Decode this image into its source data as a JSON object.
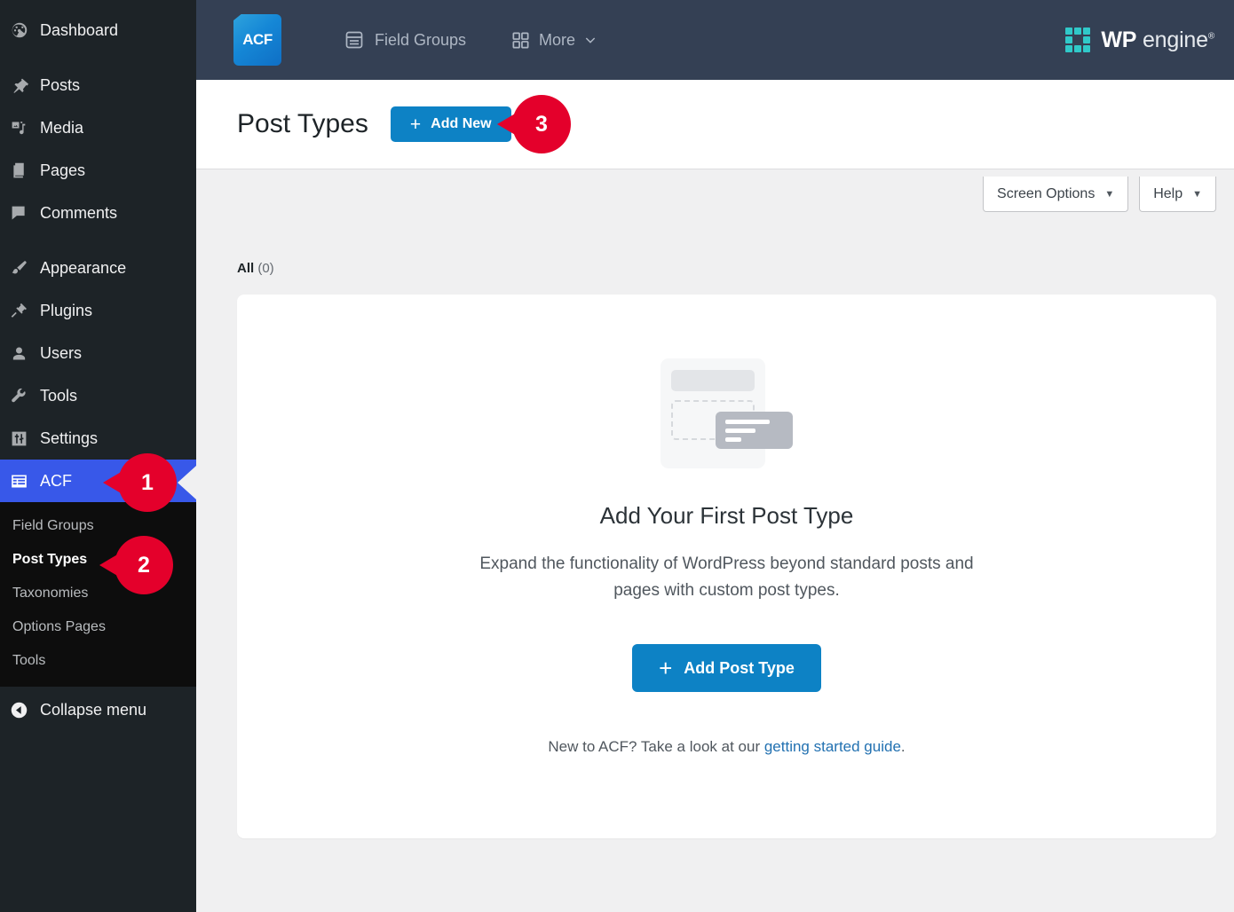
{
  "sidebar": {
    "items": [
      {
        "label": "Dashboard",
        "icon": "dashboard-icon",
        "active": false
      },
      {
        "label": "Posts",
        "icon": "pin-icon",
        "active": false
      },
      {
        "label": "Media",
        "icon": "media-icon",
        "active": false
      },
      {
        "label": "Pages",
        "icon": "pages-icon",
        "active": false
      },
      {
        "label": "Comments",
        "icon": "comments-icon",
        "active": false
      },
      {
        "label": "Appearance",
        "icon": "brush-icon",
        "active": false
      },
      {
        "label": "Plugins",
        "icon": "plug-icon",
        "active": false
      },
      {
        "label": "Users",
        "icon": "user-icon",
        "active": false
      },
      {
        "label": "Tools",
        "icon": "wrench-icon",
        "active": false
      },
      {
        "label": "Settings",
        "icon": "settings-sliders-icon",
        "active": false
      },
      {
        "label": "ACF",
        "icon": "acf-table-icon",
        "active": true
      }
    ],
    "submenu": [
      {
        "label": "Field Groups",
        "current": false
      },
      {
        "label": "Post Types",
        "current": true
      },
      {
        "label": "Taxonomies",
        "current": false
      },
      {
        "label": "Options Pages",
        "current": false
      },
      {
        "label": "Tools",
        "current": false
      }
    ],
    "collapse_label": "Collapse menu",
    "collapse_icon": "chevron-left-circle-icon",
    "active_color": "#3858e9"
  },
  "topbar": {
    "logo_text": "ACF",
    "links": [
      {
        "label": "Field Groups",
        "icon": "list-card-icon"
      },
      {
        "label": "More",
        "icon": "grid-2x2-icon",
        "caret": "chevron-down-icon"
      }
    ],
    "brand": {
      "wp": "WP",
      "engine": "engine",
      "tm": "®"
    },
    "bg_color": "#344054",
    "brand_accent": "#30c9c9"
  },
  "page": {
    "title": "Post Types",
    "add_new_label": "Add New",
    "add_new_plus": "+",
    "screen_options_label": "Screen Options",
    "help_label": "Help",
    "caret": "▼",
    "filter_all_label": "All",
    "filter_all_count": "(0)"
  },
  "empty_state": {
    "title": "Add Your First Post Type",
    "description": "Expand the functionality of WordPress beyond standard posts and pages with custom post types.",
    "button_label": "Add Post Type",
    "button_plus": "+",
    "footer_prefix": "New to ACF? Take a look at our ",
    "footer_link": "getting started guide",
    "footer_suffix": ".",
    "button_color": "#0d82c5",
    "link_color": "#2271b1"
  },
  "callouts": [
    {
      "number": "1",
      "target": "sidebar-item-acf"
    },
    {
      "number": "2",
      "target": "submenu-item-post-types"
    },
    {
      "number": "3",
      "target": "add-new-button"
    }
  ]
}
